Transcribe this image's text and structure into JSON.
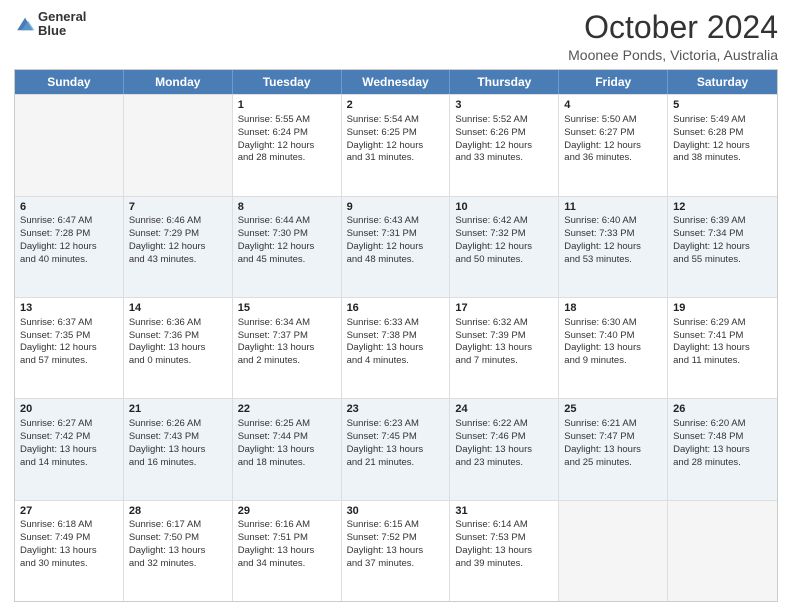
{
  "logo": {
    "line1": "General",
    "line2": "Blue"
  },
  "header": {
    "month": "October 2024",
    "location": "Moonee Ponds, Victoria, Australia"
  },
  "days_of_week": [
    "Sunday",
    "Monday",
    "Tuesday",
    "Wednesday",
    "Thursday",
    "Friday",
    "Saturday"
  ],
  "weeks": [
    [
      {
        "day": "",
        "lines": [],
        "empty": true
      },
      {
        "day": "",
        "lines": [],
        "empty": true
      },
      {
        "day": "1",
        "lines": [
          "Sunrise: 5:55 AM",
          "Sunset: 6:24 PM",
          "Daylight: 12 hours",
          "and 28 minutes."
        ]
      },
      {
        "day": "2",
        "lines": [
          "Sunrise: 5:54 AM",
          "Sunset: 6:25 PM",
          "Daylight: 12 hours",
          "and 31 minutes."
        ]
      },
      {
        "day": "3",
        "lines": [
          "Sunrise: 5:52 AM",
          "Sunset: 6:26 PM",
          "Daylight: 12 hours",
          "and 33 minutes."
        ]
      },
      {
        "day": "4",
        "lines": [
          "Sunrise: 5:50 AM",
          "Sunset: 6:27 PM",
          "Daylight: 12 hours",
          "and 36 minutes."
        ]
      },
      {
        "day": "5",
        "lines": [
          "Sunrise: 5:49 AM",
          "Sunset: 6:28 PM",
          "Daylight: 12 hours",
          "and 38 minutes."
        ]
      }
    ],
    [
      {
        "day": "6",
        "lines": [
          "Sunrise: 6:47 AM",
          "Sunset: 7:28 PM",
          "Daylight: 12 hours",
          "and 40 minutes."
        ]
      },
      {
        "day": "7",
        "lines": [
          "Sunrise: 6:46 AM",
          "Sunset: 7:29 PM",
          "Daylight: 12 hours",
          "and 43 minutes."
        ]
      },
      {
        "day": "8",
        "lines": [
          "Sunrise: 6:44 AM",
          "Sunset: 7:30 PM",
          "Daylight: 12 hours",
          "and 45 minutes."
        ]
      },
      {
        "day": "9",
        "lines": [
          "Sunrise: 6:43 AM",
          "Sunset: 7:31 PM",
          "Daylight: 12 hours",
          "and 48 minutes."
        ]
      },
      {
        "day": "10",
        "lines": [
          "Sunrise: 6:42 AM",
          "Sunset: 7:32 PM",
          "Daylight: 12 hours",
          "and 50 minutes."
        ]
      },
      {
        "day": "11",
        "lines": [
          "Sunrise: 6:40 AM",
          "Sunset: 7:33 PM",
          "Daylight: 12 hours",
          "and 53 minutes."
        ]
      },
      {
        "day": "12",
        "lines": [
          "Sunrise: 6:39 AM",
          "Sunset: 7:34 PM",
          "Daylight: 12 hours",
          "and 55 minutes."
        ]
      }
    ],
    [
      {
        "day": "13",
        "lines": [
          "Sunrise: 6:37 AM",
          "Sunset: 7:35 PM",
          "Daylight: 12 hours",
          "and 57 minutes."
        ]
      },
      {
        "day": "14",
        "lines": [
          "Sunrise: 6:36 AM",
          "Sunset: 7:36 PM",
          "Daylight: 13 hours",
          "and 0 minutes."
        ]
      },
      {
        "day": "15",
        "lines": [
          "Sunrise: 6:34 AM",
          "Sunset: 7:37 PM",
          "Daylight: 13 hours",
          "and 2 minutes."
        ]
      },
      {
        "day": "16",
        "lines": [
          "Sunrise: 6:33 AM",
          "Sunset: 7:38 PM",
          "Daylight: 13 hours",
          "and 4 minutes."
        ]
      },
      {
        "day": "17",
        "lines": [
          "Sunrise: 6:32 AM",
          "Sunset: 7:39 PM",
          "Daylight: 13 hours",
          "and 7 minutes."
        ]
      },
      {
        "day": "18",
        "lines": [
          "Sunrise: 6:30 AM",
          "Sunset: 7:40 PM",
          "Daylight: 13 hours",
          "and 9 minutes."
        ]
      },
      {
        "day": "19",
        "lines": [
          "Sunrise: 6:29 AM",
          "Sunset: 7:41 PM",
          "Daylight: 13 hours",
          "and 11 minutes."
        ]
      }
    ],
    [
      {
        "day": "20",
        "lines": [
          "Sunrise: 6:27 AM",
          "Sunset: 7:42 PM",
          "Daylight: 13 hours",
          "and 14 minutes."
        ]
      },
      {
        "day": "21",
        "lines": [
          "Sunrise: 6:26 AM",
          "Sunset: 7:43 PM",
          "Daylight: 13 hours",
          "and 16 minutes."
        ]
      },
      {
        "day": "22",
        "lines": [
          "Sunrise: 6:25 AM",
          "Sunset: 7:44 PM",
          "Daylight: 13 hours",
          "and 18 minutes."
        ]
      },
      {
        "day": "23",
        "lines": [
          "Sunrise: 6:23 AM",
          "Sunset: 7:45 PM",
          "Daylight: 13 hours",
          "and 21 minutes."
        ]
      },
      {
        "day": "24",
        "lines": [
          "Sunrise: 6:22 AM",
          "Sunset: 7:46 PM",
          "Daylight: 13 hours",
          "and 23 minutes."
        ]
      },
      {
        "day": "25",
        "lines": [
          "Sunrise: 6:21 AM",
          "Sunset: 7:47 PM",
          "Daylight: 13 hours",
          "and 25 minutes."
        ]
      },
      {
        "day": "26",
        "lines": [
          "Sunrise: 6:20 AM",
          "Sunset: 7:48 PM",
          "Daylight: 13 hours",
          "and 28 minutes."
        ]
      }
    ],
    [
      {
        "day": "27",
        "lines": [
          "Sunrise: 6:18 AM",
          "Sunset: 7:49 PM",
          "Daylight: 13 hours",
          "and 30 minutes."
        ]
      },
      {
        "day": "28",
        "lines": [
          "Sunrise: 6:17 AM",
          "Sunset: 7:50 PM",
          "Daylight: 13 hours",
          "and 32 minutes."
        ]
      },
      {
        "day": "29",
        "lines": [
          "Sunrise: 6:16 AM",
          "Sunset: 7:51 PM",
          "Daylight: 13 hours",
          "and 34 minutes."
        ]
      },
      {
        "day": "30",
        "lines": [
          "Sunrise: 6:15 AM",
          "Sunset: 7:52 PM",
          "Daylight: 13 hours",
          "and 37 minutes."
        ]
      },
      {
        "day": "31",
        "lines": [
          "Sunrise: 6:14 AM",
          "Sunset: 7:53 PM",
          "Daylight: 13 hours",
          "and 39 minutes."
        ]
      },
      {
        "day": "",
        "lines": [],
        "empty": true
      },
      {
        "day": "",
        "lines": [],
        "empty": true
      }
    ]
  ]
}
